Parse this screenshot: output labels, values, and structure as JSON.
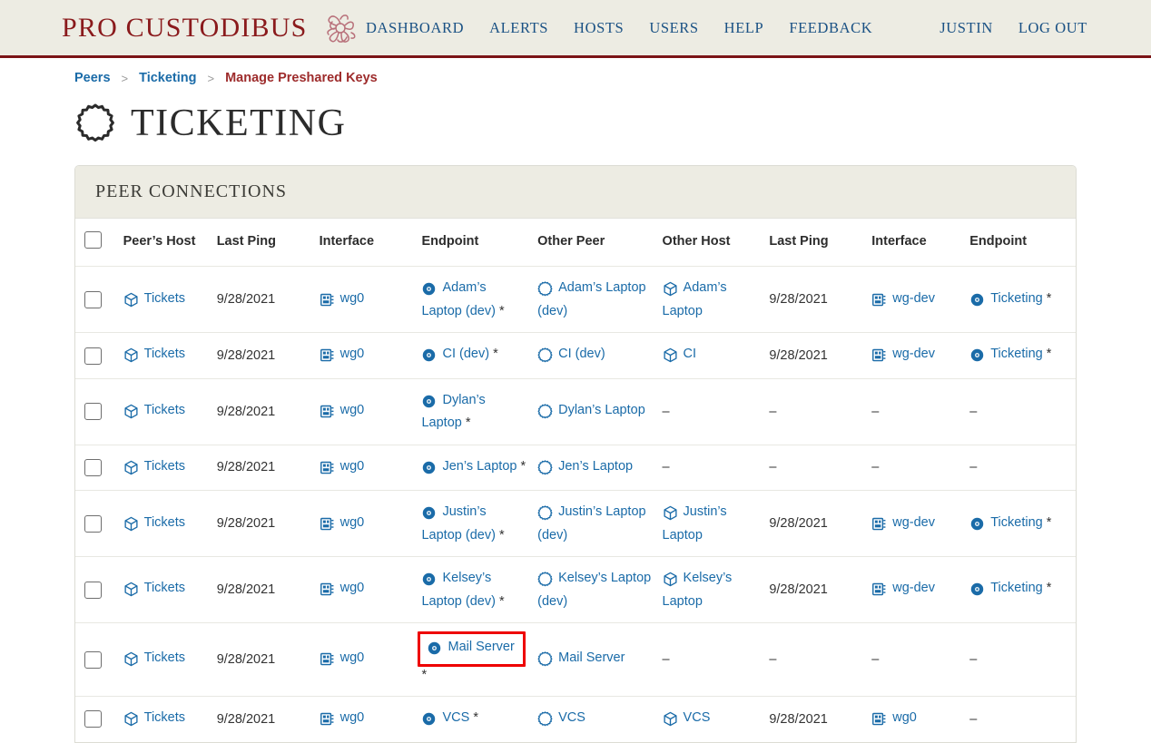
{
  "brand": {
    "name": "PRO CUSTODIBUS",
    "emblem_icon": "medusa-emblem-icon"
  },
  "nav": [
    {
      "label": "DASHBOARD",
      "name": "nav-dashboard"
    },
    {
      "label": "ALERTS",
      "name": "nav-alerts"
    },
    {
      "label": "HOSTS",
      "name": "nav-hosts"
    },
    {
      "label": "USERS",
      "name": "nav-users"
    },
    {
      "label": "HELP",
      "name": "nav-help"
    },
    {
      "label": "FEEDBACK",
      "name": "nav-feedback"
    }
  ],
  "nav_right": [
    {
      "label": "JUSTIN",
      "name": "nav-user-justin"
    },
    {
      "label": "LOG OUT",
      "name": "nav-log-out"
    }
  ],
  "breadcrumb": {
    "items": [
      {
        "label": "Peers",
        "current": false
      },
      {
        "label": "Ticketing",
        "current": false
      },
      {
        "label": "Manage Preshared Keys",
        "current": true
      }
    ],
    "separator": ">"
  },
  "page": {
    "title": "TICKETING",
    "title_icon": "gear-outline-icon"
  },
  "card": {
    "header": "PEER CONNECTIONS",
    "columns": [
      "",
      "Peer’s Host",
      "Last Ping",
      "Interface",
      "Endpoint",
      "Other Peer",
      "Other Host",
      "Last Ping",
      "Interface",
      "Endpoint"
    ],
    "rows": [
      {
        "host": "Tickets",
        "last_ping": "9/28/2021",
        "interface": "wg0",
        "endpoint": "Adam’s Laptop (dev)",
        "endpoint_star": "*",
        "endpoint_highlighted": false,
        "other_peer": "Adam’s Laptop (dev)",
        "other_host": "Adam’s Laptop",
        "other_last_ping": "9/28/2021",
        "other_interface": "wg-dev",
        "other_endpoint": "Ticketing",
        "other_endpoint_star": "*"
      },
      {
        "host": "Tickets",
        "last_ping": "9/28/2021",
        "interface": "wg0",
        "endpoint": "CI (dev)",
        "endpoint_star": "*",
        "endpoint_highlighted": false,
        "other_peer": "CI (dev)",
        "other_host": "CI",
        "other_last_ping": "9/28/2021",
        "other_interface": "wg-dev",
        "other_endpoint": "Ticketing",
        "other_endpoint_star": "*"
      },
      {
        "host": "Tickets",
        "last_ping": "9/28/2021",
        "interface": "wg0",
        "endpoint": "Dylan’s Laptop",
        "endpoint_star": "*",
        "endpoint_highlighted": false,
        "other_peer": "Dylan’s Laptop",
        "other_host": "–",
        "other_last_ping": "–",
        "other_interface": "–",
        "other_endpoint": "–",
        "other_endpoint_star": ""
      },
      {
        "host": "Tickets",
        "last_ping": "9/28/2021",
        "interface": "wg0",
        "endpoint": "Jen’s Laptop",
        "endpoint_star": "*",
        "endpoint_highlighted": false,
        "other_peer": "Jen’s Laptop",
        "other_host": "–",
        "other_last_ping": "–",
        "other_interface": "–",
        "other_endpoint": "–",
        "other_endpoint_star": ""
      },
      {
        "host": "Tickets",
        "last_ping": "9/28/2021",
        "interface": "wg0",
        "endpoint": "Justin’s Laptop (dev)",
        "endpoint_star": "*",
        "endpoint_highlighted": false,
        "other_peer": "Justin’s Laptop (dev)",
        "other_host": "Justin’s Laptop",
        "other_last_ping": "9/28/2021",
        "other_interface": "wg-dev",
        "other_endpoint": "Ticketing",
        "other_endpoint_star": "*"
      },
      {
        "host": "Tickets",
        "last_ping": "9/28/2021",
        "interface": "wg0",
        "endpoint": "Kelsey’s Laptop (dev)",
        "endpoint_star": "*",
        "endpoint_highlighted": false,
        "other_peer": "Kelsey’s Laptop (dev)",
        "other_host": "Kelsey’s Laptop",
        "other_last_ping": "9/28/2021",
        "other_interface": "wg-dev",
        "other_endpoint": "Ticketing",
        "other_endpoint_star": "*"
      },
      {
        "host": "Tickets",
        "last_ping": "9/28/2021",
        "interface": "wg0",
        "endpoint": "Mail Server",
        "endpoint_star": "*",
        "endpoint_highlighted": true,
        "other_peer": "Mail Server",
        "other_host": "–",
        "other_last_ping": "–",
        "other_interface": "–",
        "other_endpoint": "–",
        "other_endpoint_star": ""
      },
      {
        "host": "Tickets",
        "last_ping": "9/28/2021",
        "interface": "wg0",
        "endpoint": "VCS",
        "endpoint_star": "*",
        "endpoint_highlighted": false,
        "other_peer": "VCS",
        "other_host": "VCS",
        "other_last_ping": "9/28/2021",
        "other_interface": "wg0",
        "other_endpoint": "",
        "other_endpoint_star": ""
      }
    ]
  },
  "icons": {
    "host": "cube-icon",
    "interface": "chip-icon",
    "endpoint": "circle-dot-icon",
    "peer": "gear-outline-icon",
    "checkbox": "checkbox-icon"
  },
  "colors": {
    "brand_red": "#8a1a1c",
    "link_blue": "#1a6ba8",
    "nav_blue": "#1a5184",
    "header_bg": "#edece3",
    "highlight_red": "#ee0000",
    "breadcrumb_current": "#9d2b2b"
  }
}
